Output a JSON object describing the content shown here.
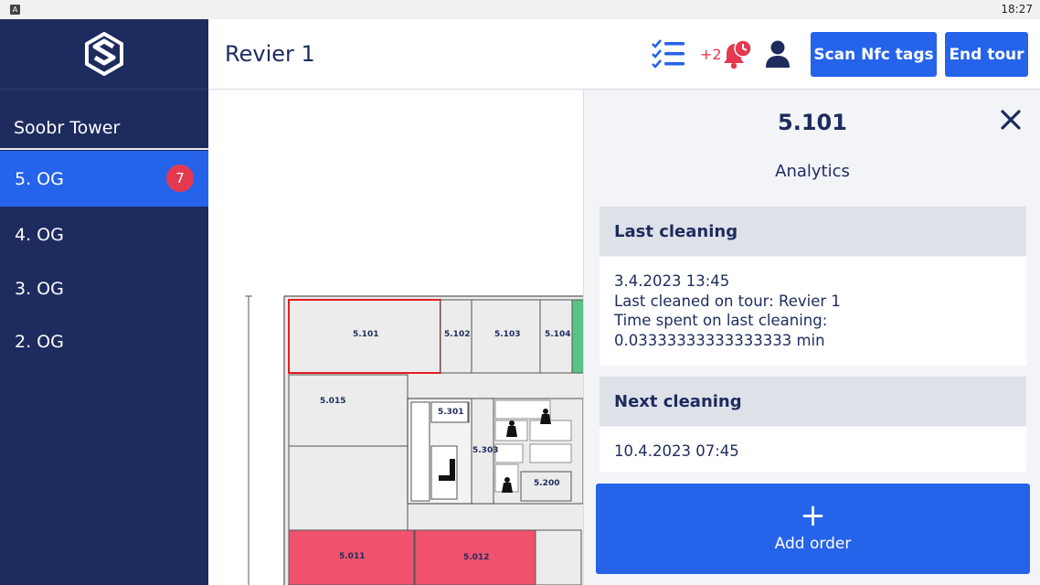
{
  "status_bar": {
    "time": "18:27",
    "app_icon_letter": "A"
  },
  "sidebar": {
    "building": "Soobr Tower",
    "floors": [
      {
        "label": "5. OG",
        "badge": "7",
        "active": true
      },
      {
        "label": "4. OG"
      },
      {
        "label": "3. OG"
      },
      {
        "label": "2. OG"
      }
    ]
  },
  "header": {
    "title": "Revier 1",
    "alert_count": "+2",
    "scan_label": "Scan Nfc tags",
    "end_tour_label": "End tour"
  },
  "map": {
    "rooms": [
      "5.101",
      "5.102",
      "5.103",
      "5.104",
      "5.015",
      "5.301",
      "5.303",
      "5.200",
      "5.011",
      "5.012"
    ]
  },
  "panel": {
    "room": "5.101",
    "subtitle": "Analytics",
    "last_cleaning": {
      "header": "Last cleaning",
      "lines": [
        "3.4.2023 13:45",
        "Last cleaned on tour: Revier 1",
        "Time spent on last cleaning:",
        "0.03333333333333333 min"
      ]
    },
    "next_cleaning": {
      "header": "Next cleaning",
      "lines": [
        "10.4.2023 07:45"
      ]
    },
    "add_order": {
      "plus": "+",
      "label": "Add order"
    }
  },
  "colors": {
    "sidebar_bg": "#1e2b5e",
    "accent_blue": "#2563eb",
    "alert_red": "#e53950",
    "room_red_fill": "#f0526e",
    "room_green_fill": "#58c486",
    "selected_outline": "#e02020"
  }
}
